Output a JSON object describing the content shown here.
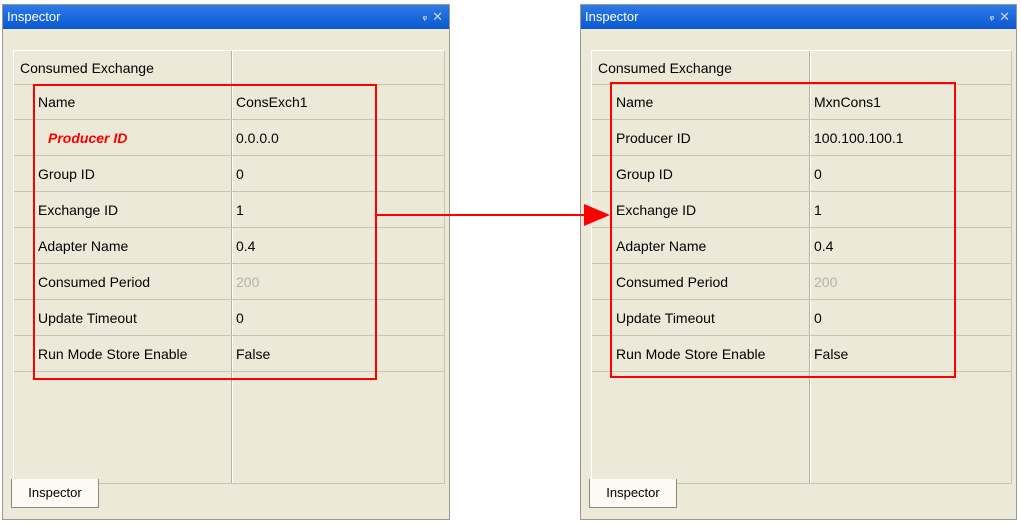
{
  "panels": {
    "left": {
      "title": "Inspector",
      "pin": "ᵩ",
      "close": "✕",
      "category": "Consumed Exchange",
      "rows": [
        {
          "name": "Name",
          "value": "ConsExch1"
        },
        {
          "name": "Producer ID",
          "value": "0.0.0.0"
        },
        {
          "name": "Group ID",
          "value": "0"
        },
        {
          "name": "Exchange ID",
          "value": "1"
        },
        {
          "name": "Adapter Name",
          "value": "0.4"
        },
        {
          "name": "Consumed Period",
          "value": "200"
        },
        {
          "name": "Update Timeout",
          "value": "0"
        },
        {
          "name": "Run Mode Store Enable",
          "value": "False"
        }
      ],
      "tab": "Inspector"
    },
    "right": {
      "title": "Inspector",
      "pin": "ᵩ",
      "close": "✕",
      "category": "Consumed Exchange",
      "rows": [
        {
          "name": "Name",
          "value": "MxnCons1"
        },
        {
          "name": "Producer ID",
          "value": "100.100.100.1"
        },
        {
          "name": "Group ID",
          "value": "0"
        },
        {
          "name": "Exchange ID",
          "value": "1"
        },
        {
          "name": "Adapter Name",
          "value": "0.4"
        },
        {
          "name": "Consumed Period",
          "value": "200"
        },
        {
          "name": "Update Timeout",
          "value": "0"
        },
        {
          "name": "Run Mode Store Enable",
          "value": "False"
        }
      ],
      "tab": "Inspector"
    }
  },
  "colors": {
    "title_bar": "#0a58d0",
    "highlight": "#ff0000",
    "panel_bg": "#ece9d8"
  }
}
